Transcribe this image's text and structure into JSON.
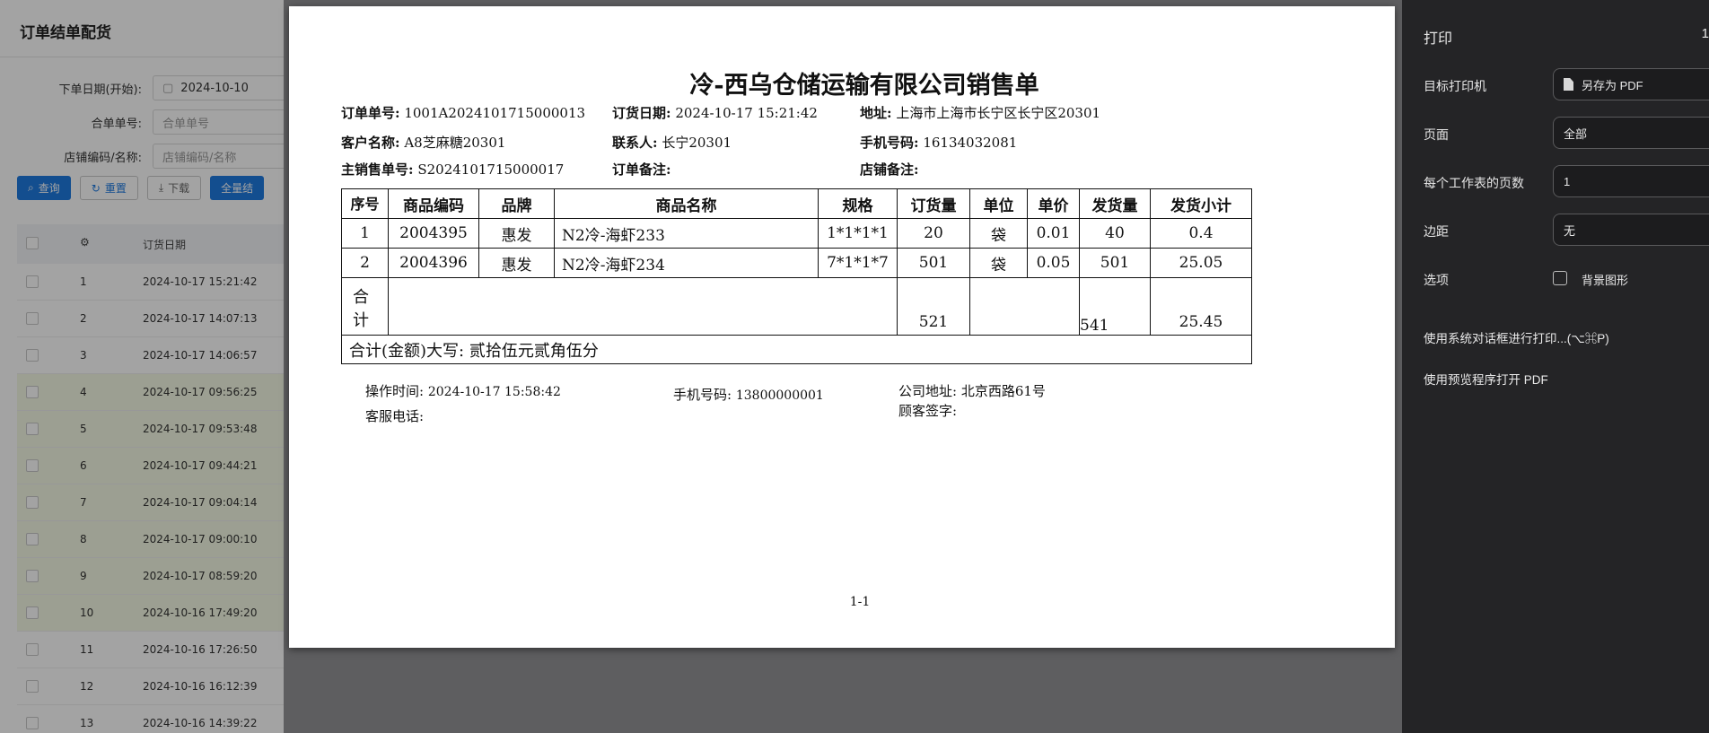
{
  "bg_app": {
    "title": "订单结单配货",
    "fields": [
      {
        "label": "下单日期(开始):",
        "value": "2024-10-10"
      },
      {
        "label": "合单单号:",
        "value": "合单单号"
      },
      {
        "label": "店铺编码/名称:",
        "value": "店铺编码/名称"
      }
    ],
    "buttons": {
      "query": "查询",
      "reset": "重置",
      "download": "下载",
      "full": "全量结"
    },
    "column_date": "订货日期",
    "rows": [
      {
        "n": "1",
        "date": "2024-10-17 15:21:42",
        "hl": false
      },
      {
        "n": "2",
        "date": "2024-10-17 14:07:13",
        "hl": false
      },
      {
        "n": "3",
        "date": "2024-10-17 14:06:57",
        "hl": false
      },
      {
        "n": "4",
        "date": "2024-10-17 09:56:25",
        "hl": true
      },
      {
        "n": "5",
        "date": "2024-10-17 09:53:48",
        "hl": true
      },
      {
        "n": "6",
        "date": "2024-10-17 09:44:21",
        "hl": true
      },
      {
        "n": "7",
        "date": "2024-10-17 09:04:14",
        "hl": true
      },
      {
        "n": "8",
        "date": "2024-10-17 09:00:10",
        "hl": true
      },
      {
        "n": "9",
        "date": "2024-10-17 08:59:20",
        "hl": true
      },
      {
        "n": "10",
        "date": "2024-10-16 17:49:20",
        "hl": true
      },
      {
        "n": "11",
        "date": "2024-10-16 17:26:50",
        "hl": false
      },
      {
        "n": "12",
        "date": "2024-10-16 16:12:39",
        "hl": false
      },
      {
        "n": "13",
        "date": "2024-10-16 14:39:22",
        "hl": false
      }
    ]
  },
  "sheet": {
    "title": "冷-西乌仓储运输有限公司销售单",
    "order_no_label": "订单单号:",
    "order_no": "1001A2024101715000013",
    "order_date_label": "订货日期:",
    "order_date": "2024-10-17 15:21:42",
    "address_label": "地址:",
    "address": "上海市上海市长宁区长宁区20301",
    "customer_label": "客户名称:",
    "customer": "A8芝麻糖20301",
    "contact_label": "联系人:",
    "contact": "长宁20301",
    "phone_label": "手机号码:",
    "phone": "16134032081",
    "main_sale_label": "主销售单号:",
    "main_sale": "S2024101715000017",
    "order_remark_label": "订单备注:",
    "shop_remark_label": "店铺备注:",
    "columns": [
      "序号",
      "商品编码",
      "品牌",
      "商品名称",
      "规格",
      "订货量",
      "单位",
      "单价",
      "发货量",
      "发货小计"
    ],
    "items": [
      {
        "seq": "1",
        "code": "2004395",
        "brand": "惠发",
        "name": "N2冷-海虾233",
        "spec": "1*1*1*1",
        "qty": "20",
        "unit": "袋",
        "price": "0.01",
        "ship": "40",
        "subtotal": "0.4"
      },
      {
        "seq": "2",
        "code": "2004396",
        "brand": "惠发",
        "name": "N2冷-海虾234",
        "spec": "7*1*1*7",
        "qty": "501",
        "unit": "袋",
        "price": "0.05",
        "ship": "501",
        "subtotal": "25.05"
      }
    ],
    "total_label": "合计",
    "total_qty": "521",
    "total_ship": "541",
    "total_amount": "25.45",
    "amount_words": "合计(金额)大写:  贰拾伍元贰角伍分",
    "op_time_label": "操作时间:",
    "op_time": "2024-10-17 15:58:42",
    "foot_phone_label": "手机号码:",
    "foot_phone": "13800000001",
    "company_addr_label": "公司地址:",
    "company_addr": "北京西路61号",
    "service_phone_label": "客服电话:",
    "signature_label": "顾客签字:",
    "page_no": "1-1"
  },
  "panel": {
    "title": "打印",
    "count": "1",
    "printer_label": "目标打印机",
    "printer_value": "另存为 PDF",
    "pages_label": "页面",
    "pages_value": "全部",
    "per_sheet_label": "每个工作表的页数",
    "per_sheet_value": "1",
    "margin_label": "边距",
    "margin_value": "无",
    "options_label": "选项",
    "background_label": "背景图形",
    "system_dialog": "使用系统对话框进行打印...(⌥⌘P)",
    "open_pdf": "使用预览程序打开 PDF"
  }
}
